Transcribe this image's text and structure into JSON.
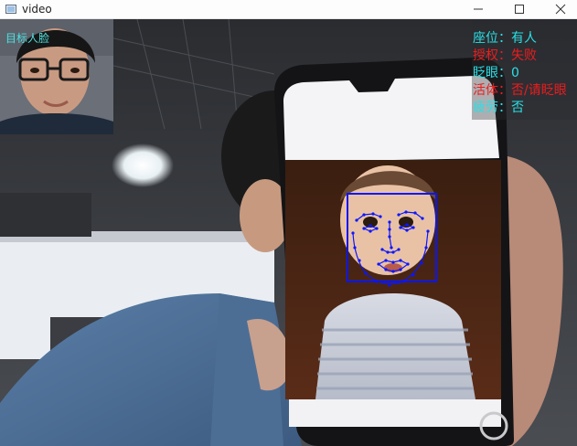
{
  "window": {
    "title": "video",
    "controls": {
      "minimize": "minimize-icon",
      "maximize": "maximize-icon",
      "close": "close-icon"
    }
  },
  "thumbnail": {
    "label": "目标人脸"
  },
  "status": {
    "seat": {
      "label": "座位：",
      "value": "有人",
      "color": "#29e0e6"
    },
    "auth": {
      "label": "授权：",
      "value": "失败",
      "color": "#ee1c1c"
    },
    "blink": {
      "label": "眨眼：",
      "value": "0",
      "color": "#29e0e6"
    },
    "liveness": {
      "label": "活体：",
      "value": "否/请眨眼",
      "color": "#ee1c1c"
    },
    "fatigue": {
      "label": "疲劳：",
      "value": "否",
      "color": "#29e0e6"
    }
  },
  "overlay": {
    "face_box_color": "#0b16ff",
    "landmark_color": "#0b16ff"
  }
}
